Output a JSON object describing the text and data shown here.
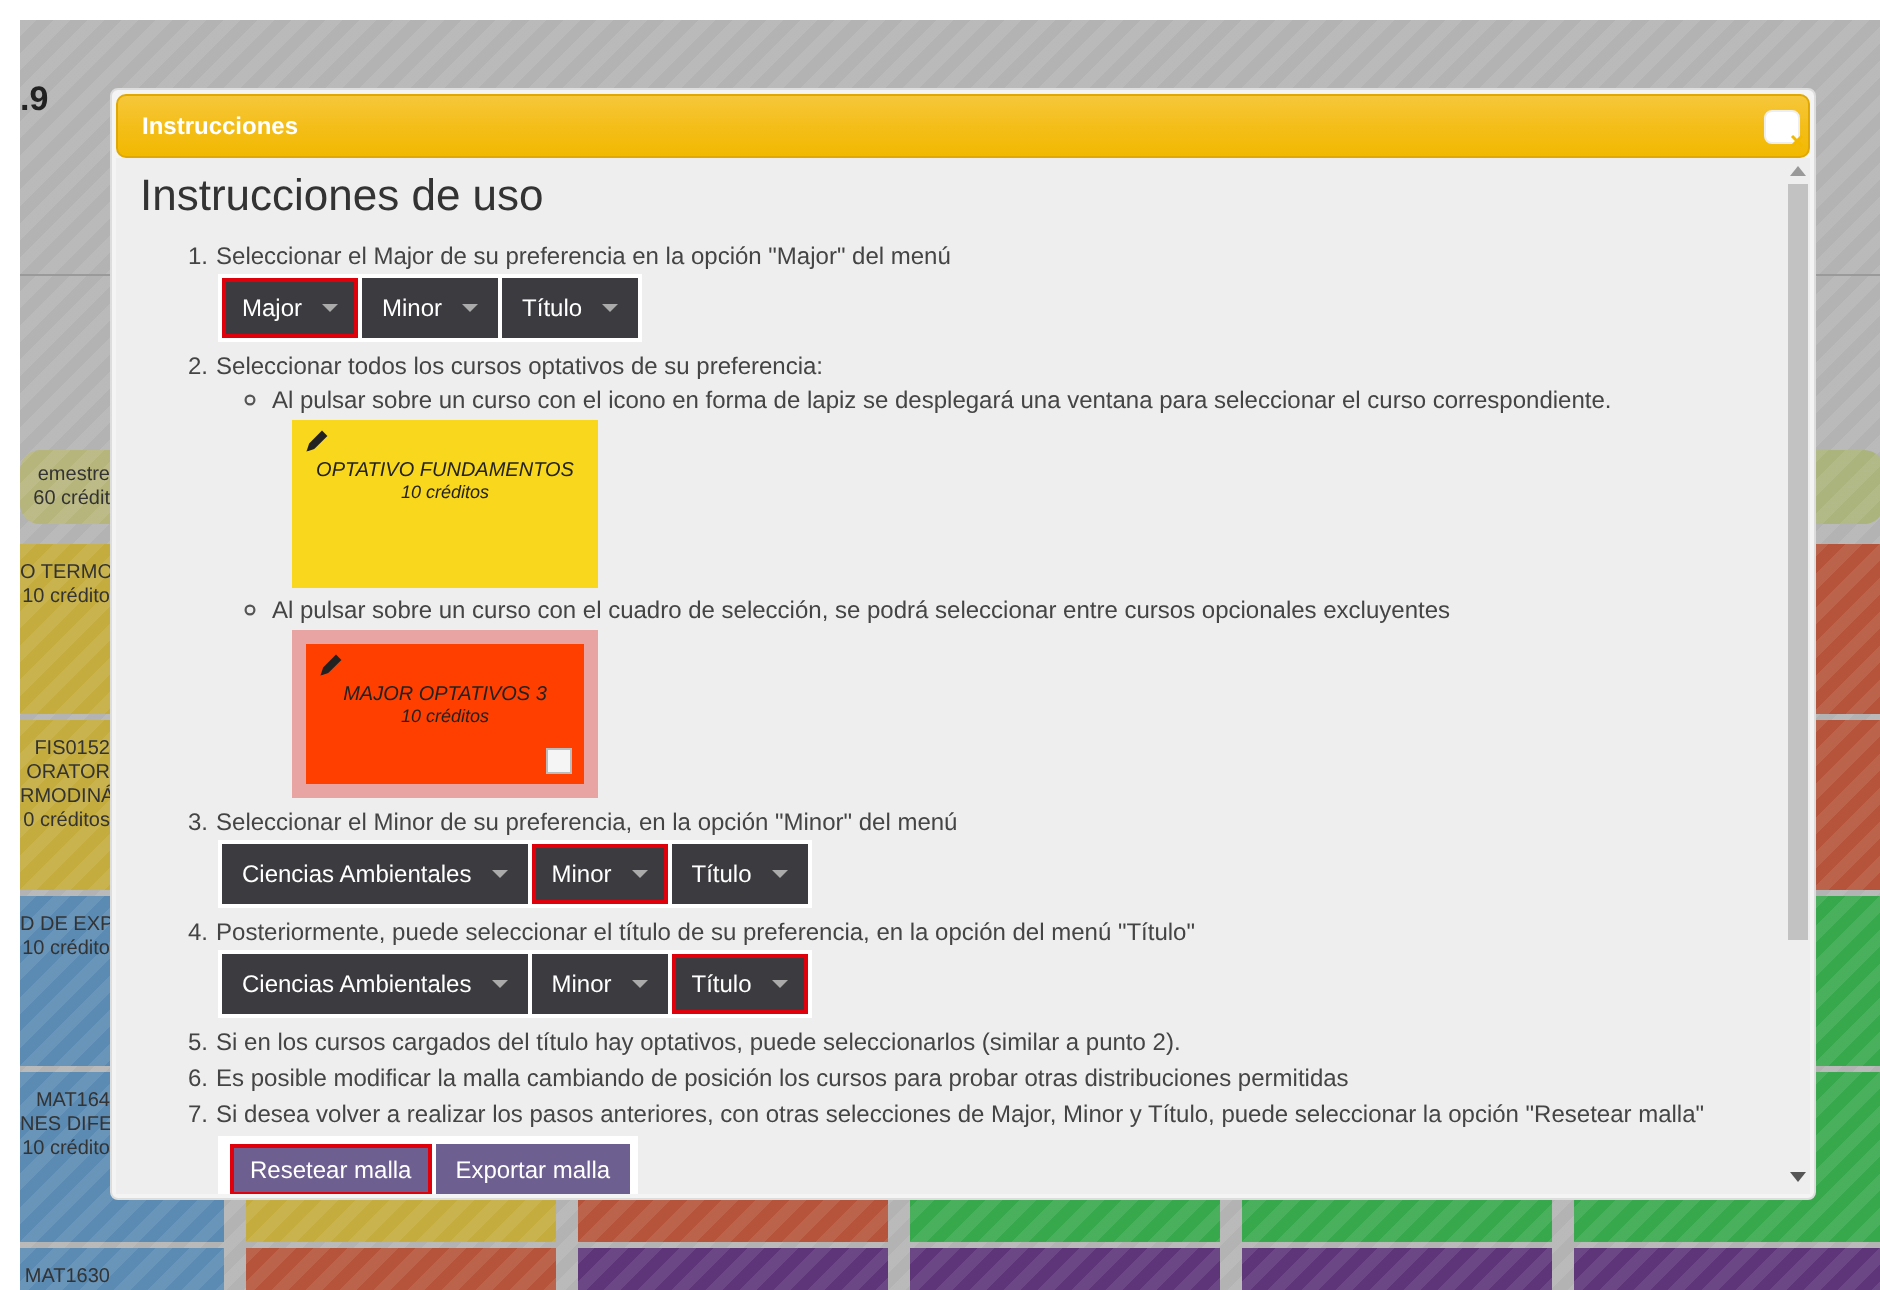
{
  "page": {
    "title": ".9"
  },
  "grid": {
    "rows": [
      {
        "kind": "header",
        "cells": [
          {
            "color": "#b6b57c",
            "lines": [
              "emestre",
              "60 crédit"
            ]
          },
          {
            "color": "#aab47c"
          }
        ]
      },
      {
        "kind": "course",
        "cells": [
          {
            "color": "#c4ac3e",
            "lines": [
              "O TERMO",
              "10 crédito"
            ]
          },
          {
            "color": "#b5543a"
          }
        ]
      },
      {
        "kind": "course",
        "cells": [
          {
            "color": "#c4ac3e",
            "lines": [
              "FIS0152",
              "ORATOR",
              "RMODINÁ",
              "0 créditos"
            ]
          },
          {
            "color": "#b5543a"
          }
        ]
      },
      {
        "kind": "course",
        "cells": [
          {
            "color": "#5b8bb3",
            "lines": [
              "D DE EXP",
              "10 crédito"
            ]
          },
          {
            "color": "#37a84c"
          }
        ]
      },
      {
        "kind": "course",
        "cells": [
          {
            "color": "#5b8bb3",
            "lines": [
              "MAT164",
              "NES DIFE",
              "10 crédito"
            ]
          },
          {
            "color": "#c4ac3e"
          },
          {
            "color": "#b5543a"
          },
          {
            "color": "#37a84c"
          },
          {
            "color": "#37a84c"
          },
          {
            "color": "#37a84c"
          }
        ]
      },
      {
        "kind": "course",
        "cells": [
          {
            "color": "#5b8bb3",
            "lines": [
              "MAT1630"
            ]
          },
          {
            "color": "#b5543a"
          },
          {
            "color": "#5e3579"
          },
          {
            "color": "#5e3579"
          },
          {
            "color": "#5e3579"
          },
          {
            "color": "#5e3579"
          }
        ]
      }
    ]
  },
  "dialog": {
    "title": "Instrucciones",
    "heading": "Instrucciones de uso",
    "steps": [
      {
        "number": "1.",
        "text": "Seleccionar el Major de su preferencia en la opción \"Major\" del menú",
        "menu": [
          {
            "label": "Major",
            "highlighted": true
          },
          {
            "label": "Minor",
            "highlighted": false
          },
          {
            "label": "Título",
            "highlighted": false
          }
        ]
      },
      {
        "number": "2.",
        "text": "Seleccionar todos los cursos optativos de su preferencia:",
        "bullets": [
          {
            "text": "Al pulsar sobre un curso con el icono en forma de lapiz se desplegará una ventana para seleccionar el curso correspondiente.",
            "course": {
              "kind": "pencil",
              "name": "OPTATIVO FUNDAMENTOS",
              "credits": "10 créditos",
              "color": "#f9d71c"
            }
          },
          {
            "text": "Al pulsar sobre un curso con el cuadro de selección, se podrá seleccionar entre cursos opcionales excluyentes",
            "course": {
              "kind": "selectable",
              "name": "MAJOR OPTATIVOS 3",
              "credits": "10 créditos",
              "color": "#ff3f00",
              "checked": false
            }
          }
        ]
      },
      {
        "number": "3.",
        "text": "Seleccionar el Minor de su preferencia, en la opción \"Minor\" del menú",
        "menu": [
          {
            "label": "Ciencias Ambientales",
            "highlighted": false
          },
          {
            "label": "Minor",
            "highlighted": true
          },
          {
            "label": "Título",
            "highlighted": false
          }
        ]
      },
      {
        "number": "4.",
        "text": "Posteriormente, puede seleccionar el título de su preferencia, en la opción del menú \"Título\"",
        "menu": [
          {
            "label": "Ciencias Ambientales",
            "highlighted": false
          },
          {
            "label": "Minor",
            "highlighted": false
          },
          {
            "label": "Título",
            "highlighted": true
          }
        ]
      },
      {
        "number": "5.",
        "text": "Si en los cursos cargados del título hay optativos, puede seleccionarlos (similar a punto 2)."
      },
      {
        "number": "6.",
        "text": "Es posible modificar la malla cambiando de posición los cursos para probar otras distribuciones permitidas"
      },
      {
        "number": "7.",
        "text": "Si desea volver a realizar los pasos anteriores, con otras selecciones de Major, Minor y Título, puede seleccionar la opción \"Resetear malla\"",
        "buttons": [
          {
            "label": "Resetear malla",
            "highlighted": true
          },
          {
            "label": "Exportar malla",
            "highlighted": false
          }
        ]
      }
    ]
  }
}
